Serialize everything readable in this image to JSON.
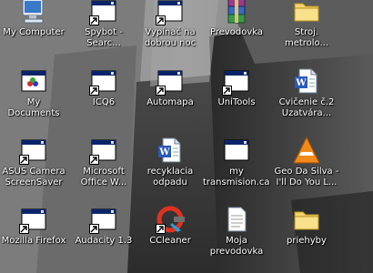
{
  "desktop": {
    "icons": [
      {
        "label": "My Computer",
        "type": "computer",
        "shortcut": false
      },
      {
        "label": "Spybot -\nSearc...",
        "type": "app",
        "shortcut": true
      },
      {
        "label": "Vypínač na\ndobrou noc",
        "type": "app",
        "shortcut": true
      },
      {
        "label": "Prevodovka",
        "type": "winrar",
        "shortcut": false
      },
      {
        "label": "Stroj.\nmetrolo...",
        "type": "folder",
        "shortcut": false
      },
      {
        "label": "My Documents",
        "type": "mydocs",
        "shortcut": false
      },
      {
        "label": "ICQ6",
        "type": "app",
        "shortcut": true
      },
      {
        "label": "Automapa",
        "type": "app",
        "shortcut": true
      },
      {
        "label": "UniTools",
        "type": "app",
        "shortcut": true
      },
      {
        "label": "Cvičenie č.2\nUzatvára...",
        "type": "word",
        "shortcut": false
      },
      {
        "label": "ASUS Camera\nScreenSaver",
        "type": "app",
        "shortcut": true
      },
      {
        "label": "Microsoft\nOffice W...",
        "type": "app",
        "shortcut": true
      },
      {
        "label": "recyklacia\nodpadu",
        "type": "word",
        "shortcut": false
      },
      {
        "label": "my\ntransmision.cal",
        "type": "app",
        "shortcut": false
      },
      {
        "label": "Geo Da Silva -\nI'll Do You L...",
        "type": "vlc",
        "shortcut": false
      },
      {
        "label": "Mozilla Firefox",
        "type": "app",
        "shortcut": true
      },
      {
        "label": "Audacity 1.3",
        "type": "app",
        "shortcut": true
      },
      {
        "label": "CCleaner",
        "type": "ccleaner",
        "shortcut": true
      },
      {
        "label": "Moja\nprevodovka",
        "type": "textdoc",
        "shortcut": false
      },
      {
        "label": "priehyby",
        "type": "folder",
        "shortcut": false
      }
    ]
  }
}
